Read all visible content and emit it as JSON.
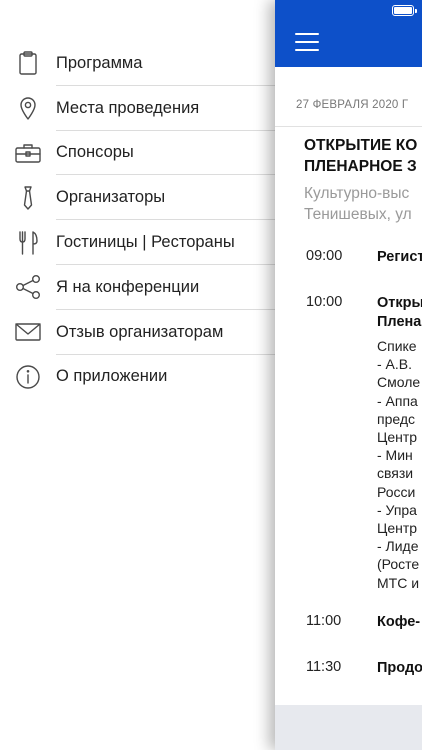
{
  "menu": {
    "items": [
      {
        "label": "Программа",
        "icon": "clipboard-icon"
      },
      {
        "label": "Места проведения",
        "icon": "map-pin-icon"
      },
      {
        "label": "Спонсоры",
        "icon": "briefcase-icon"
      },
      {
        "label": "Организаторы",
        "icon": "tie-icon"
      },
      {
        "label": "Гостиницы | Рестораны",
        "icon": "fork-knife-icon"
      },
      {
        "label": "Я на конференции",
        "icon": "share-icon"
      },
      {
        "label": "Отзыв организаторам",
        "icon": "mail-icon"
      },
      {
        "label": "О приложении",
        "icon": "info-icon"
      }
    ]
  },
  "panel": {
    "header_color": "#0d50c9",
    "date": "27 ФЕВРАЛЯ 2020 Г",
    "event_title_line1": "ОТКРЫТИЕ КО",
    "event_title_line2": "ПЛЕНАРНОЕ З",
    "venue_line1": "Культурно-выс",
    "venue_line2": "Тенишевых, ул",
    "schedule": [
      {
        "time": "09:00",
        "title_lines": [
          "Регист"
        ],
        "desc_lines": []
      },
      {
        "time": "10:00",
        "title_lines": [
          "Откры",
          "Плена"
        ],
        "desc_lines": [
          "Спике",
          "- А.В.",
          "Смоле",
          "- Аппа",
          "предс",
          "Центр",
          "- Мин",
          "связи",
          "Росси",
          "- Упра",
          "Центр",
          "- Лиде",
          "(Росте",
          "МТС и"
        ]
      },
      {
        "time": "11:00",
        "title_lines": [
          "Кофе-"
        ],
        "desc_lines": []
      },
      {
        "time": "11:30",
        "title_lines": [
          "Продо"
        ],
        "desc_lines": []
      }
    ]
  }
}
